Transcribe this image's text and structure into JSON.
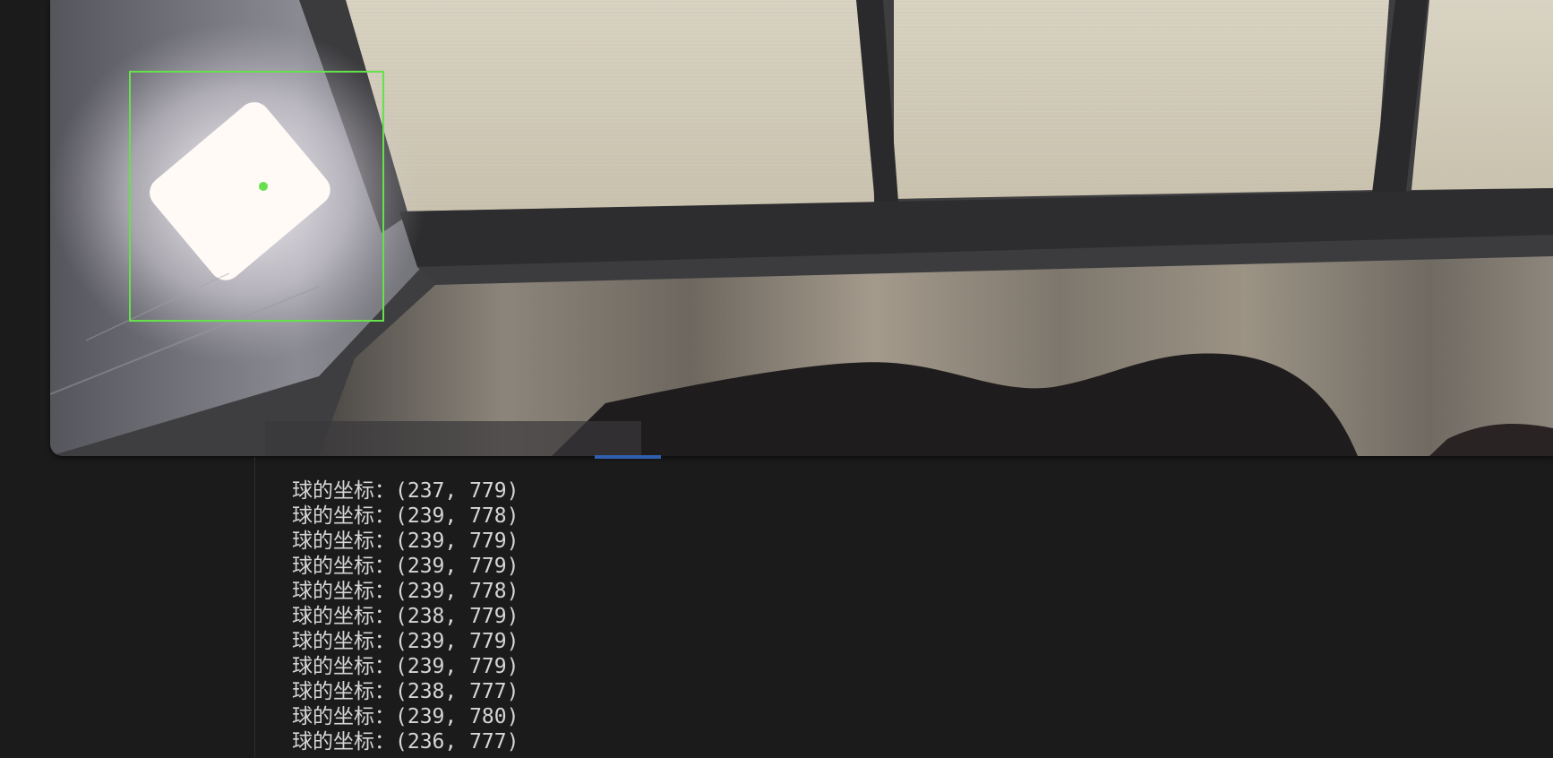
{
  "console": {
    "lines": [
      "球的坐标：(237, 779)",
      "球的坐标：(239, 778)",
      "球的坐标：(239, 779)",
      "球的坐标：(239, 779)",
      "球的坐标：(239, 778)",
      "球的坐标：(238, 779)",
      "球的坐标：(239, 779)",
      "球的坐标：(239, 779)",
      "球的坐标：(238, 777)",
      "球的坐标：(239, 780)",
      "球的坐标：(236, 777)"
    ]
  },
  "colors": {
    "background": "#1b1b1c",
    "console_text": "#d6d6d6",
    "detection_box": "#64e14b",
    "scroll_indicator": "#2f5fae"
  }
}
